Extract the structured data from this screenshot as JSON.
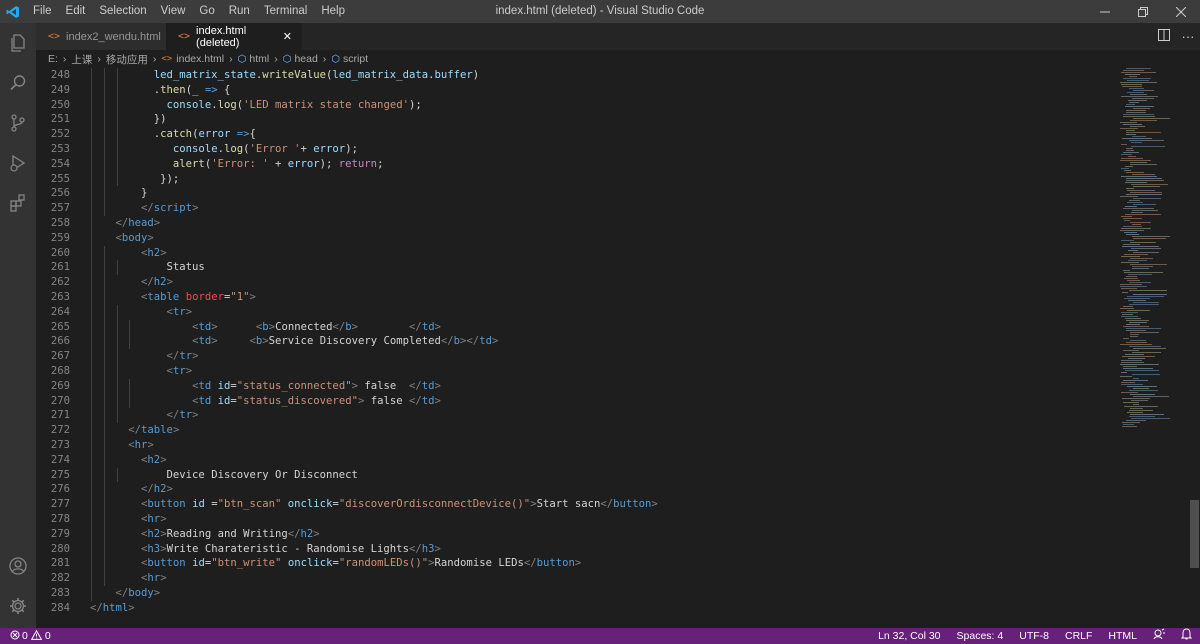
{
  "window": {
    "title": "index.html (deleted) - Visual Studio Code",
    "menu": [
      "File",
      "Edit",
      "Selection",
      "View",
      "Go",
      "Run",
      "Terminal",
      "Help"
    ]
  },
  "tabs": [
    {
      "label": "index2_wendu.html",
      "active": false
    },
    {
      "label": "index.html (deleted)",
      "active": true
    }
  ],
  "breadcrumb": {
    "drive": "E:",
    "folder1": "上课",
    "folder2": "移动应用",
    "file": "index.html",
    "sym1": "html",
    "sym2": "head",
    "sym3": "script"
  },
  "code_lines": [
    {
      "n": "248",
      "indent": 5,
      "tokens": [
        [
          "a",
          "led_matrix_state"
        ],
        [
          "x",
          "."
        ],
        [
          "f",
          "writeValue"
        ],
        [
          "x",
          "("
        ],
        [
          "a",
          "led_matrix_data"
        ],
        [
          "x",
          "."
        ],
        [
          "a",
          "buffer"
        ],
        [
          "x",
          ")"
        ]
      ]
    },
    {
      "n": "249",
      "indent": 5,
      "tokens": [
        [
          "x",
          "."
        ],
        [
          "f",
          "then"
        ],
        [
          "x",
          "(_ "
        ],
        [
          "t",
          "=>"
        ],
        [
          "x",
          " {"
        ]
      ]
    },
    {
      "n": "250",
      "indent": 6,
      "tokens": [
        [
          "a",
          "console"
        ],
        [
          "x",
          "."
        ],
        [
          "f",
          "log"
        ],
        [
          "x",
          "("
        ],
        [
          "s",
          "'LED matrix state changed'"
        ],
        [
          "x",
          ");"
        ]
      ]
    },
    {
      "n": "251",
      "indent": 5,
      "tokens": [
        [
          "x",
          "})"
        ]
      ]
    },
    {
      "n": "252",
      "indent": 5,
      "tokens": [
        [
          "x",
          "."
        ],
        [
          "f",
          "catch"
        ],
        [
          "x",
          "("
        ],
        [
          "a",
          "error"
        ],
        [
          "x",
          " "
        ],
        [
          "t",
          "=>"
        ],
        [
          "x",
          "{"
        ]
      ]
    },
    {
      "n": "253",
      "indent": 6,
      "pad": 1,
      "tokens": [
        [
          "a",
          "console"
        ],
        [
          "x",
          "."
        ],
        [
          "f",
          "log"
        ],
        [
          "x",
          "("
        ],
        [
          "s",
          "'Error '"
        ],
        [
          "x",
          "+ "
        ],
        [
          "a",
          "error"
        ],
        [
          "x",
          ");"
        ]
      ]
    },
    {
      "n": "254",
      "indent": 6,
      "pad": 1,
      "tokens": [
        [
          "f",
          "alert"
        ],
        [
          "x",
          "("
        ],
        [
          "s",
          "'Error: '"
        ],
        [
          "x",
          " + "
        ],
        [
          "a",
          "error"
        ],
        [
          "x",
          "); "
        ],
        [
          "k",
          "return"
        ],
        [
          "x",
          ";"
        ]
      ]
    },
    {
      "n": "255",
      "indent": 5,
      "pad": 1,
      "tokens": [
        [
          "x",
          "});"
        ]
      ]
    },
    {
      "n": "256",
      "indent": 4,
      "tokens": [
        [
          "x",
          "}"
        ]
      ]
    },
    {
      "n": "257",
      "indent": 4,
      "tokens": [
        [
          "p",
          "</"
        ],
        [
          "t",
          "script"
        ],
        [
          "p",
          ">"
        ]
      ]
    },
    {
      "n": "258",
      "indent": 2,
      "tokens": [
        [
          "p",
          "</"
        ],
        [
          "t",
          "head"
        ],
        [
          "p",
          ">"
        ]
      ]
    },
    {
      "n": "259",
      "indent": 2,
      "tokens": [
        [
          "p",
          "<"
        ],
        [
          "t",
          "body"
        ],
        [
          "p",
          ">"
        ]
      ]
    },
    {
      "n": "260",
      "indent": 4,
      "tokens": [
        [
          "p",
          "<"
        ],
        [
          "t",
          "h2"
        ],
        [
          "p",
          ">"
        ]
      ]
    },
    {
      "n": "261",
      "indent": 6,
      "tokens": [
        [
          "x",
          "Status"
        ]
      ]
    },
    {
      "n": "262",
      "indent": 4,
      "tokens": [
        [
          "p",
          "</"
        ],
        [
          "t",
          "h2"
        ],
        [
          "p",
          ">"
        ]
      ]
    },
    {
      "n": "263",
      "indent": 4,
      "tokens": [
        [
          "p",
          "<"
        ],
        [
          "t",
          "table"
        ],
        [
          "x",
          " "
        ],
        [
          "r",
          "border"
        ],
        [
          "x",
          "="
        ],
        [
          "s",
          "\"1\""
        ],
        [
          "p",
          ">"
        ]
      ]
    },
    {
      "n": "264",
      "indent": 6,
      "tokens": [
        [
          "p",
          "<"
        ],
        [
          "t",
          "tr"
        ],
        [
          "p",
          ">"
        ]
      ]
    },
    {
      "n": "265",
      "indent": 8,
      "tokens": [
        [
          "p",
          "<"
        ],
        [
          "t",
          "td"
        ],
        [
          "p",
          ">"
        ],
        [
          "x",
          "      "
        ],
        [
          "p",
          "<"
        ],
        [
          "t",
          "b"
        ],
        [
          "p",
          ">"
        ],
        [
          "x",
          "Connected"
        ],
        [
          "p",
          "</"
        ],
        [
          "t",
          "b"
        ],
        [
          "p",
          ">"
        ],
        [
          "x",
          "        "
        ],
        [
          "p",
          "</"
        ],
        [
          "t",
          "td"
        ],
        [
          "p",
          ">"
        ]
      ]
    },
    {
      "n": "266",
      "indent": 8,
      "tokens": [
        [
          "p",
          "<"
        ],
        [
          "t",
          "td"
        ],
        [
          "p",
          ">"
        ],
        [
          "x",
          "     "
        ],
        [
          "p",
          "<"
        ],
        [
          "t",
          "b"
        ],
        [
          "p",
          ">"
        ],
        [
          "x",
          "Service Discovery Completed"
        ],
        [
          "p",
          "</"
        ],
        [
          "t",
          "b"
        ],
        [
          "p",
          "></"
        ],
        [
          "t",
          "td"
        ],
        [
          "p",
          ">"
        ]
      ]
    },
    {
      "n": "267",
      "indent": 6,
      "tokens": [
        [
          "p",
          "</"
        ],
        [
          "t",
          "tr"
        ],
        [
          "p",
          ">"
        ]
      ]
    },
    {
      "n": "268",
      "indent": 6,
      "tokens": [
        [
          "p",
          "<"
        ],
        [
          "t",
          "tr"
        ],
        [
          "p",
          ">"
        ]
      ]
    },
    {
      "n": "269",
      "indent": 8,
      "tokens": [
        [
          "p",
          "<"
        ],
        [
          "t",
          "td"
        ],
        [
          "x",
          " "
        ],
        [
          "a",
          "id"
        ],
        [
          "x",
          "="
        ],
        [
          "s",
          "\"status_connected\""
        ],
        [
          "p",
          ">"
        ],
        [
          "x",
          " false  "
        ],
        [
          "p",
          "</"
        ],
        [
          "t",
          "td"
        ],
        [
          "p",
          ">"
        ]
      ]
    },
    {
      "n": "270",
      "indent": 8,
      "tokens": [
        [
          "p",
          "<"
        ],
        [
          "t",
          "td"
        ],
        [
          "x",
          " "
        ],
        [
          "a",
          "id"
        ],
        [
          "x",
          "="
        ],
        [
          "s",
          "\"status_discovered\""
        ],
        [
          "p",
          ">"
        ],
        [
          "x",
          " false "
        ],
        [
          "p",
          "</"
        ],
        [
          "t",
          "td"
        ],
        [
          "p",
          ">"
        ]
      ]
    },
    {
      "n": "271",
      "indent": 6,
      "tokens": [
        [
          "p",
          "</"
        ],
        [
          "t",
          "tr"
        ],
        [
          "p",
          ">"
        ]
      ]
    },
    {
      "n": "272",
      "indent": 3,
      "tokens": [
        [
          "p",
          "</"
        ],
        [
          "t",
          "table"
        ],
        [
          "p",
          ">"
        ]
      ]
    },
    {
      "n": "273",
      "indent": 3,
      "tokens": [
        [
          "p",
          "<"
        ],
        [
          "t",
          "hr"
        ],
        [
          "p",
          ">"
        ]
      ]
    },
    {
      "n": "274",
      "indent": 4,
      "tokens": [
        [
          "p",
          "<"
        ],
        [
          "t",
          "h2"
        ],
        [
          "p",
          ">"
        ]
      ]
    },
    {
      "n": "275",
      "indent": 6,
      "tokens": [
        [
          "x",
          "Device Discovery Or Disconnect"
        ]
      ]
    },
    {
      "n": "276",
      "indent": 4,
      "tokens": [
        [
          "p",
          "</"
        ],
        [
          "t",
          "h2"
        ],
        [
          "p",
          ">"
        ]
      ]
    },
    {
      "n": "277",
      "indent": 4,
      "tokens": [
        [
          "p",
          "<"
        ],
        [
          "t",
          "button"
        ],
        [
          "x",
          " "
        ],
        [
          "a",
          "id"
        ],
        [
          "x",
          " ="
        ],
        [
          "s",
          "\"btn_scan\""
        ],
        [
          "x",
          " "
        ],
        [
          "a",
          "onclick"
        ],
        [
          "x",
          "="
        ],
        [
          "s",
          "\"discoverOrdisconnectDevice()\""
        ],
        [
          "p",
          ">"
        ],
        [
          "x",
          "Start sacn"
        ],
        [
          "p",
          "</"
        ],
        [
          "t",
          "button"
        ],
        [
          "p",
          ">"
        ]
      ]
    },
    {
      "n": "278",
      "indent": 4,
      "tokens": [
        [
          "p",
          "<"
        ],
        [
          "t",
          "hr"
        ],
        [
          "p",
          ">"
        ]
      ]
    },
    {
      "n": "279",
      "indent": 4,
      "tokens": [
        [
          "p",
          "<"
        ],
        [
          "t",
          "h2"
        ],
        [
          "p",
          ">"
        ],
        [
          "x",
          "Reading and Writing"
        ],
        [
          "p",
          "</"
        ],
        [
          "t",
          "h2"
        ],
        [
          "p",
          ">"
        ]
      ]
    },
    {
      "n": "280",
      "indent": 4,
      "tokens": [
        [
          "p",
          "<"
        ],
        [
          "t",
          "h3"
        ],
        [
          "p",
          ">"
        ],
        [
          "x",
          "Write Charateristic - Randomise Lights"
        ],
        [
          "p",
          "</"
        ],
        [
          "t",
          "h3"
        ],
        [
          "p",
          ">"
        ]
      ]
    },
    {
      "n": "281",
      "indent": 4,
      "tokens": [
        [
          "p",
          "<"
        ],
        [
          "t",
          "button"
        ],
        [
          "x",
          " "
        ],
        [
          "a",
          "id"
        ],
        [
          "x",
          "="
        ],
        [
          "s",
          "\"btn_write\""
        ],
        [
          "x",
          " "
        ],
        [
          "a",
          "onclick"
        ],
        [
          "x",
          "="
        ],
        [
          "s",
          "\"randomLEDs()\""
        ],
        [
          "p",
          ">"
        ],
        [
          "x",
          "Randomise LEDs"
        ],
        [
          "p",
          "</"
        ],
        [
          "t",
          "button"
        ],
        [
          "p",
          ">"
        ]
      ]
    },
    {
      "n": "282",
      "indent": 4,
      "tokens": [
        [
          "p",
          "<"
        ],
        [
          "t",
          "hr"
        ],
        [
          "p",
          ">"
        ]
      ]
    },
    {
      "n": "283",
      "indent": 2,
      "tokens": [
        [
          "p",
          "</"
        ],
        [
          "t",
          "body"
        ],
        [
          "p",
          ">"
        ]
      ]
    },
    {
      "n": "284",
      "indent": 0,
      "tokens": [
        [
          "p",
          "</"
        ],
        [
          "t",
          "html"
        ],
        [
          "p",
          ">"
        ]
      ]
    }
  ],
  "status": {
    "errors": "0",
    "warnings": "0",
    "position": "Ln 32, Col 30",
    "spaces": "Spaces: 4",
    "encoding": "UTF-8",
    "eol": "CRLF",
    "language": "HTML"
  },
  "colors": {
    "statusbar": "#68217a",
    "titlebar": "#3c3c3c",
    "activitybar": "#333333",
    "editor": "#1e1e1e"
  }
}
